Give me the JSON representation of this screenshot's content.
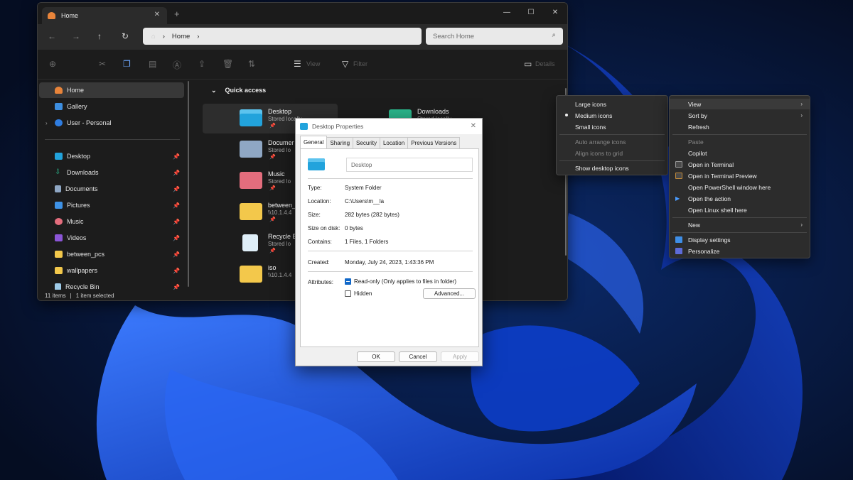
{
  "explorer": {
    "tab_title": "Home",
    "address_path": "Home",
    "search_placeholder": "Search Home",
    "toolbar": {
      "view_label": "View",
      "filter_label": "Filter",
      "details_label": "Details"
    },
    "sidebar": {
      "top_items": [
        {
          "label": "Home",
          "icon": "home-icon",
          "selected": true
        },
        {
          "label": "Gallery",
          "icon": "gallery-icon"
        },
        {
          "label": "User - Personal",
          "icon": "onedrive-icon"
        }
      ],
      "pinned_items": [
        {
          "label": "Desktop",
          "icon": "desktop-folder-icon"
        },
        {
          "label": "Downloads",
          "icon": "downloads-icon"
        },
        {
          "label": "Documents",
          "icon": "documents-icon"
        },
        {
          "label": "Pictures",
          "icon": "pictures-icon"
        },
        {
          "label": "Music",
          "icon": "music-icon"
        },
        {
          "label": "Videos",
          "icon": "videos-icon"
        },
        {
          "label": "between_pcs",
          "icon": "folder-icon"
        },
        {
          "label": "wallpapers",
          "icon": "folder-icon"
        },
        {
          "label": "Recycle Bin",
          "icon": "recycle-bin-icon"
        }
      ]
    },
    "quick_access": {
      "header": "Quick access",
      "items": [
        {
          "name": "Desktop",
          "subtitle": "Stored locally",
          "icon": "desktop-folder-icon",
          "selected": true
        },
        {
          "name": "Downloads",
          "subtitle": "Stored locally",
          "icon": "downloads-folder-icon"
        },
        {
          "name": "Documer",
          "subtitle": "Stored lo",
          "icon": "documents-folder-icon"
        },
        {
          "name": "Music",
          "subtitle": "Stored lo",
          "icon": "music-folder-icon"
        },
        {
          "name": "between_",
          "subtitle": "\\\\10.1.4.4",
          "icon": "network-folder-icon"
        },
        {
          "name": "Recycle B",
          "subtitle": "Stored lo",
          "icon": "recycle-bin-icon"
        },
        {
          "name": "iso",
          "subtitle": "\\\\10.1.4.4",
          "icon": "network-folder-icon"
        }
      ]
    },
    "status": {
      "items": "11 items",
      "separator": "|",
      "selected": "1 item selected"
    }
  },
  "properties": {
    "title": "Desktop Properties",
    "tabs": [
      "General",
      "Sharing",
      "Security",
      "Location",
      "Previous Versions"
    ],
    "active_tab": "General",
    "folder_name": "Desktop",
    "rows": [
      {
        "label": "Type:",
        "value": "System Folder"
      },
      {
        "label": "Location:",
        "value": "C:\\Users\\m__la"
      },
      {
        "label": "Size:",
        "value": "282 bytes (282 bytes)"
      },
      {
        "label": "Size on disk:",
        "value": "0 bytes"
      },
      {
        "label": "Contains:",
        "value": "1 Files, 1 Folders"
      }
    ],
    "created": {
      "label": "Created:",
      "value": "Monday, July 24, 2023, 1:43:36 PM"
    },
    "attributes": {
      "label": "Attributes:",
      "readonly_label": "Read-only (Only applies to files in folder)",
      "readonly_state": "indeterminate",
      "hidden_label": "Hidden",
      "hidden_checked": false,
      "advanced_label": "Advanced..."
    },
    "buttons": {
      "ok": "OK",
      "cancel": "Cancel",
      "apply": "Apply"
    }
  },
  "view_submenu": {
    "items": [
      {
        "label": "Large icons"
      },
      {
        "label": "Medium icons",
        "checked": true
      },
      {
        "label": "Small icons"
      },
      {
        "label": "Auto arrange icons",
        "disabled": true
      },
      {
        "label": "Align icons to grid",
        "disabled": true
      },
      {
        "label": "Show desktop icons"
      }
    ]
  },
  "desktop_menu": {
    "items": [
      {
        "label": "View",
        "submenu": true
      },
      {
        "label": "Sort by",
        "submenu": true
      },
      {
        "label": "Refresh"
      },
      {
        "label": "Paste",
        "disabled": true
      },
      {
        "label": "Copilot"
      },
      {
        "label": "Open in Terminal",
        "icon": "terminal-icon"
      },
      {
        "label": "Open in Terminal Preview",
        "icon": "terminal-preview-icon"
      },
      {
        "label": "Open PowerShell window here"
      },
      {
        "label": "Open the action",
        "icon": "play-icon"
      },
      {
        "label": "Open Linux shell here"
      },
      {
        "label": "New",
        "submenu": true
      },
      {
        "label": "Display settings",
        "icon": "display-icon"
      },
      {
        "label": "Personalize",
        "icon": "personalize-icon"
      }
    ]
  },
  "colors": {
    "explorer_bg": "#1c1c1c",
    "accent_blue": "#1168c9",
    "desktop_folder": "#22a3dc",
    "downloads_folder": "#2bb58b",
    "music_folder": "#e36d7d",
    "folder_yellow": "#f3c84b"
  }
}
